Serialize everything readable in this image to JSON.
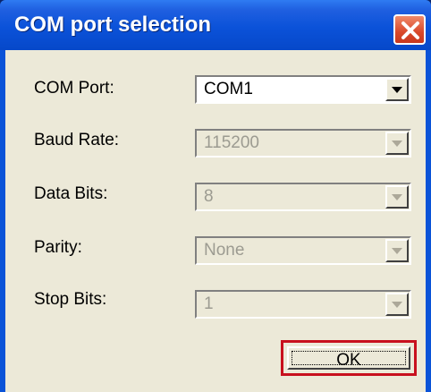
{
  "window": {
    "title": "COM port selection",
    "close_icon": "close-icon"
  },
  "fields": [
    {
      "label": "COM Port:",
      "value": "COM1",
      "enabled": true
    },
    {
      "label": "Baud Rate:",
      "value": "115200",
      "enabled": false
    },
    {
      "label": "Data Bits:",
      "value": "8",
      "enabled": false
    },
    {
      "label": "Parity:",
      "value": "None",
      "enabled": false
    },
    {
      "label": "Stop Bits:",
      "value": "1",
      "enabled": false
    }
  ],
  "buttons": {
    "ok_label": "OK"
  },
  "colors": {
    "titlebar": "#0b52d9",
    "close_button": "#d9482a",
    "dialog_background": "#ece9d8",
    "ok_highlight": "#c8101e"
  }
}
